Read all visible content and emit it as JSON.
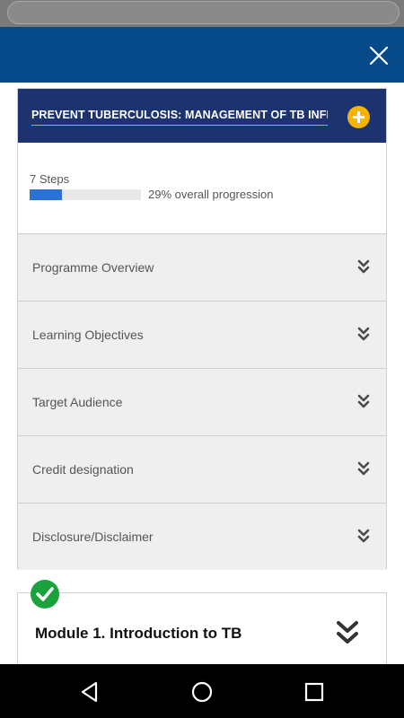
{
  "app": {
    "header_color": "#064a8a"
  },
  "course": {
    "title": "PREVENT TUBERCULOSIS: MANAGEMENT OF TB INFECTION",
    "steps_label": "7 Steps",
    "progress_fraction": 0.29,
    "progress_label": "29% overall progression",
    "accent_color": "#f4b400",
    "title_bar_color": "#1d3370",
    "sections": [
      {
        "label": "Programme Overview"
      },
      {
        "label": "Learning Objectives"
      },
      {
        "label": "Target Audience"
      },
      {
        "label": "Credit designation"
      },
      {
        "label": "Disclosure/Disclaimer"
      }
    ]
  },
  "module": {
    "title": "Module 1. Introduction to TB",
    "status": "completed",
    "status_color": "#1aa33c"
  },
  "icons": {
    "close": "close-icon",
    "expand": "plus-circle-icon",
    "section_toggle": "double-chevron-down-icon",
    "completed": "check-circle-icon",
    "nav_back": "back-triangle-icon",
    "nav_home": "home-circle-icon",
    "nav_recents": "recents-square-icon"
  }
}
